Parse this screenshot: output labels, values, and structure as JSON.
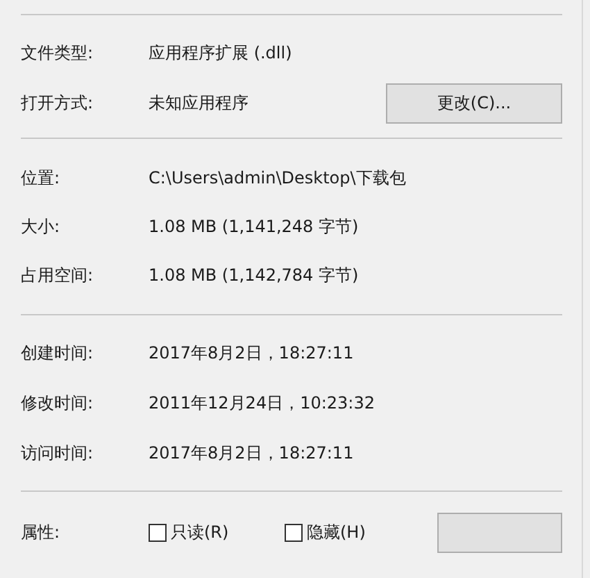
{
  "general": [
    {
      "label": "文件类型:",
      "value": "应用程序扩展 (.dll)"
    },
    {
      "label": "打开方式:",
      "value": "未知应用程序",
      "button": "更改(C)..."
    }
  ],
  "location": [
    {
      "label": "位置:",
      "value": "C:\\Users\\admin\\Desktop\\下载包"
    },
    {
      "label": "大小:",
      "value": "1.08 MB (1,141,248 字节)"
    },
    {
      "label": "占用空间:",
      "value": "1.08 MB (1,142,784 字节)"
    }
  ],
  "times": [
    {
      "label": "创建时间:",
      "value": "2017年8月2日，18:27:11"
    },
    {
      "label": "修改时间:",
      "value": "2011年12月24日，10:23:32"
    },
    {
      "label": "访问时间:",
      "value": "2017年8月2日，18:27:11"
    }
  ],
  "attributes": {
    "label": "属性:",
    "options": [
      {
        "label": "只读(R)",
        "checked": false
      },
      {
        "label": "隐藏(H)",
        "checked": false
      }
    ]
  }
}
